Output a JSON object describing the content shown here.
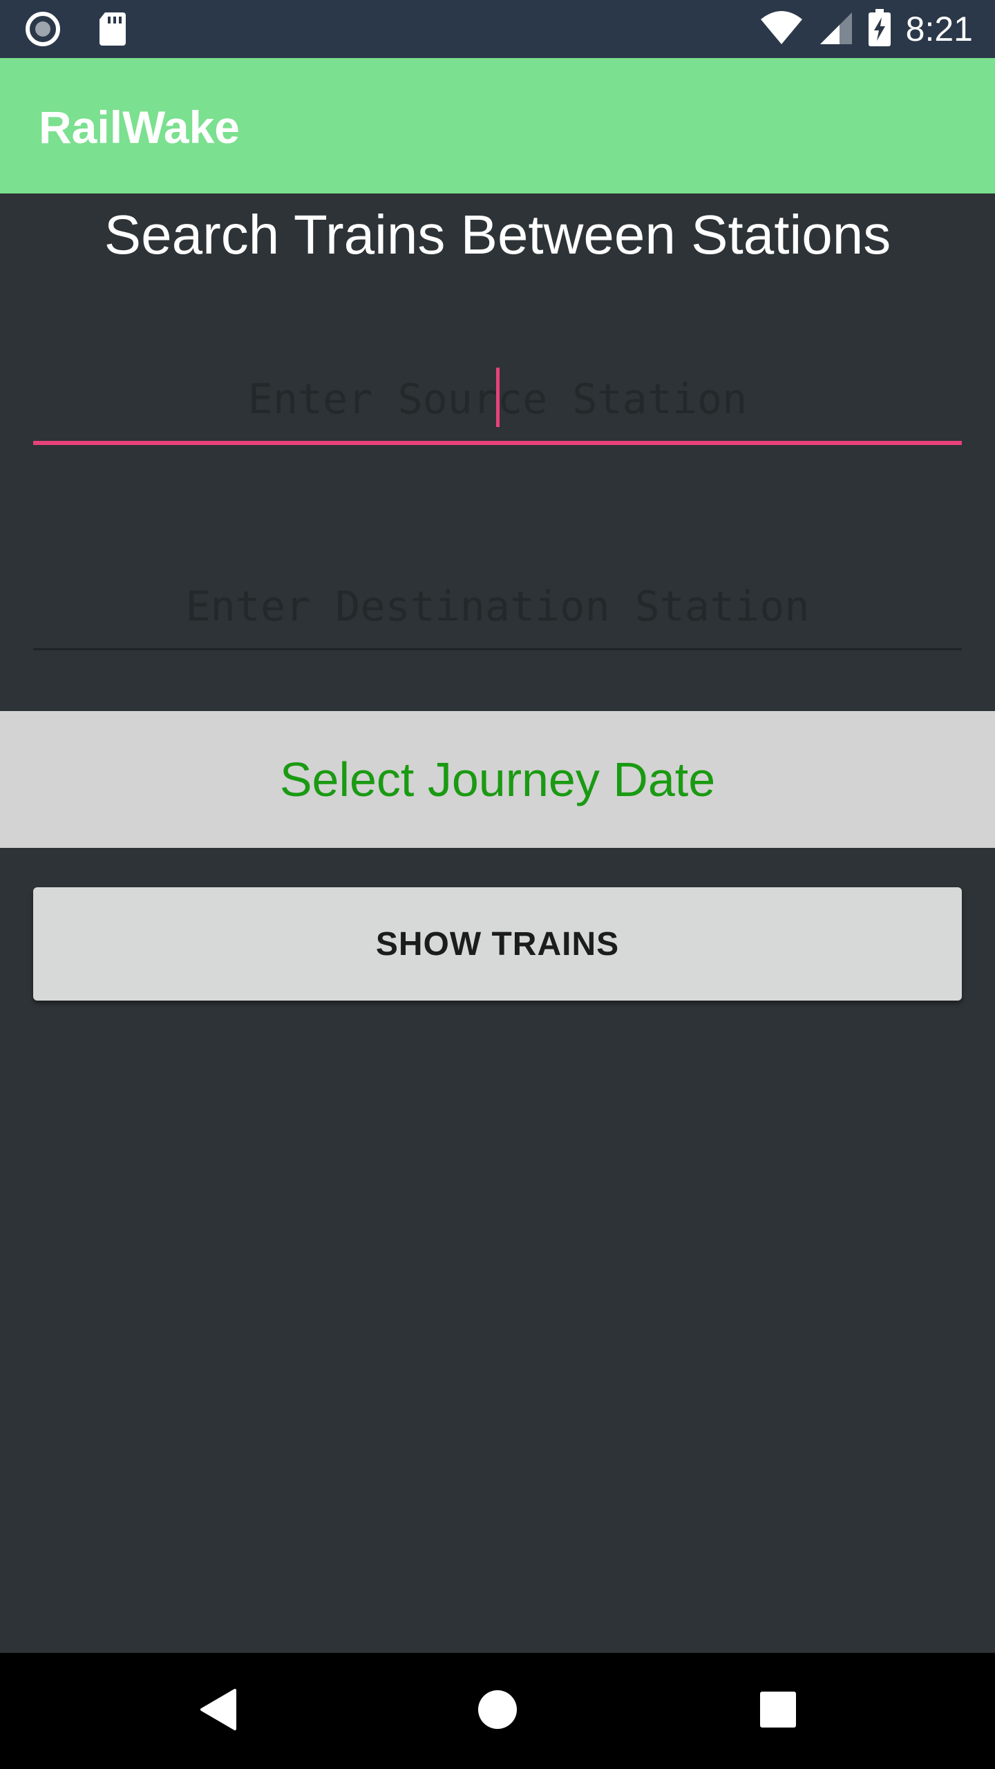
{
  "status_bar": {
    "time": "8:21",
    "left_icons": [
      "record-icon",
      "sd-card-icon"
    ],
    "right_icons": [
      "wifi-icon",
      "signal-icon",
      "battery-charging-icon"
    ]
  },
  "app_bar": {
    "title": "RailWake",
    "background": "#7be08f"
  },
  "main": {
    "heading": "Search Trains Between Stations",
    "source_field": {
      "placeholder": "Enter Source Station",
      "value": "",
      "focused": true
    },
    "destination_field": {
      "placeholder": "Enter Destination Station",
      "value": ""
    },
    "date_selector": {
      "label": "Select Journey Date",
      "color": "#1a9a12"
    },
    "show_trains_button": {
      "label": "SHOW TRAINS"
    }
  },
  "nav_bar": {
    "buttons": [
      "back-icon",
      "home-icon",
      "recents-icon"
    ]
  },
  "colors": {
    "accent": "#e8427a",
    "background": "#2d3336",
    "status_bar": "#2b3849"
  }
}
